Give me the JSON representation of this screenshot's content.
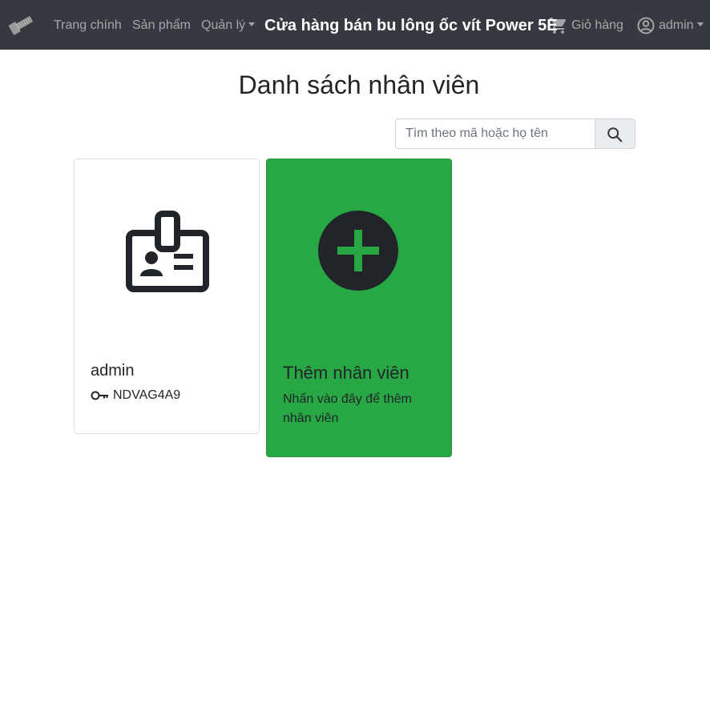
{
  "navbar": {
    "links": {
      "home": "Trang chính",
      "products": "Sản phẩm",
      "manage": "Quản lý"
    },
    "brand": "Cửa hàng bán bu lông ốc vít Power 5E",
    "cart_label": "Giỏ hàng",
    "user_label": "admin",
    "icons": {
      "logo": "bolt-logo-icon",
      "cart": "cart-icon",
      "user": "user-circle-icon"
    },
    "colors": {
      "background": "#343a40",
      "link": "#a6a8aa",
      "brand": "#ffffff"
    }
  },
  "main": {
    "title": "Danh sách nhân viên",
    "search": {
      "placeholder": "Tìm theo mã hoặc họ tên",
      "value": "",
      "button_icon": "search-icon"
    },
    "employees": [
      {
        "name": "admin",
        "id": "NDVAG4A9",
        "icon": "id-badge-icon",
        "id_icon": "key-icon"
      }
    ],
    "add_card": {
      "title": "Thêm nhân viên",
      "description": "Nhấn vào đây để thêm nhân viên",
      "icon": "plus-circle-icon",
      "color": "#28a745"
    }
  }
}
